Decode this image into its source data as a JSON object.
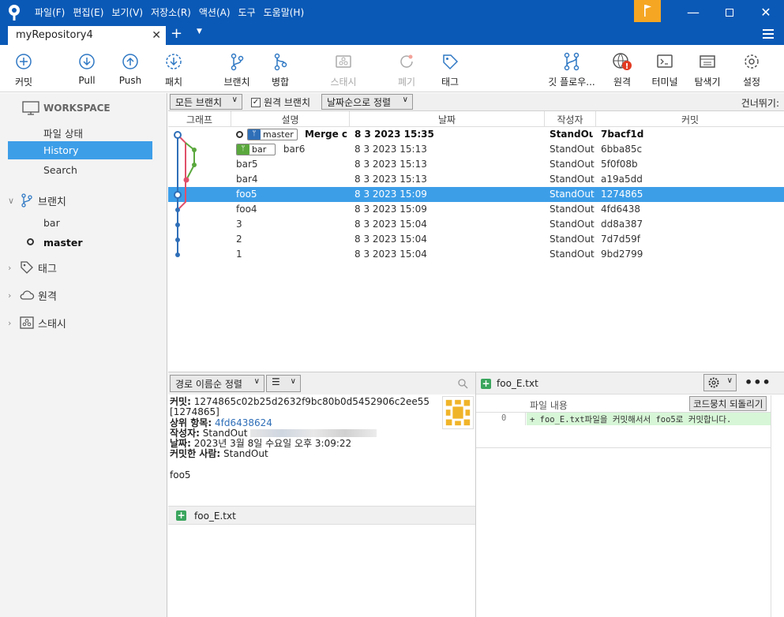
{
  "window": {
    "menu": [
      "파일(F)",
      "편집(E)",
      "보기(V)",
      "저장소(R)",
      "액션(A)",
      "도구",
      "도움말(H)"
    ],
    "tab_title": "myRepository4"
  },
  "toolbar": {
    "commit": "커밋",
    "pull": "Pull",
    "push": "Push",
    "fetch": "패치",
    "branch": "브랜치",
    "merge": "병합",
    "stash": "스태시",
    "discard": "폐기",
    "tag": "태그",
    "gitflow": "깃 플로우...",
    "remote": "원격",
    "terminal": "터미널",
    "explorer": "탐색기",
    "settings": "설정"
  },
  "sidebar": {
    "workspace_title": "WORKSPACE",
    "workspace_items": [
      "파일 상태",
      "History",
      "Search"
    ],
    "selected_item": "History",
    "branches_title": "브랜치",
    "branches": [
      "bar",
      "master"
    ],
    "current_branch": "master",
    "tags_title": "태그",
    "remotes_title": "원격",
    "stashes_title": "스태시"
  },
  "filters": {
    "branches": "모든 브랜치",
    "remote_branches": "원격 브랜치",
    "remote_checked": true,
    "sort": "날짜순으로 정렬",
    "jump": "건너뛰기:"
  },
  "columns": [
    "그래프",
    "설명",
    "날짜",
    "작성자",
    "커밋"
  ],
  "commits": [
    {
      "description": "Merge c",
      "ref": "master",
      "date": "8 3 2023 15:35",
      "author": "StandOut",
      "hash": "7bacf1d",
      "bold": true
    },
    {
      "description": "bar6",
      "ref": "bar",
      "date": "8 3 2023 15:13",
      "author": "StandOut",
      "hash": "6bba85c"
    },
    {
      "description": "bar5",
      "date": "8 3 2023 15:13",
      "author": "StandOut",
      "hash": "5f0f08b"
    },
    {
      "description": "bar4",
      "date": "8 3 2023 15:13",
      "author": "StandOut",
      "hash": "a19a5dd"
    },
    {
      "description": "foo5",
      "date": "8 3 2023 15:09",
      "author": "StandOut",
      "hash": "1274865",
      "selected": true
    },
    {
      "description": "foo4",
      "date": "8 3 2023 15:09",
      "author": "StandOut",
      "hash": "4fd6438"
    },
    {
      "description": "3",
      "date": "8 3 2023 15:04",
      "author": "StandOut",
      "hash": "dd8a387"
    },
    {
      "description": "2",
      "date": "8 3 2023 15:04",
      "author": "StandOut",
      "hash": "7d7d59f"
    },
    {
      "description": "1",
      "date": "8 3 2023 15:04",
      "author": "StandOut",
      "hash": "9bd2799"
    }
  ],
  "details": {
    "sort": "경로 이름순 정렬",
    "commit_label": "커밋:",
    "commit_full": "1274865c02b25d2632f9bc80b0d5452906c2ee55",
    "commit_short": "[1274865]",
    "parent_label": "상위 항목:",
    "parent": "4fd6438624",
    "author_label": "작성자:",
    "author": "StandOut",
    "date_label": "날짜:",
    "date": "2023년 3월 8일 수요일 오후 3:09:22",
    "committer_label": "커밋한 사람:",
    "committer": "StandOut",
    "message": "foo5",
    "file": "foo_E.txt"
  },
  "diff": {
    "file": "foo_E.txt",
    "content_label": "파일 내용",
    "revert_button": "코드뭉치 되돌리기",
    "line_number": "0",
    "line_text": "+ foo_E.txt파일을 커밋해서서 foo5로 커밋합니다."
  },
  "colors": {
    "titlebar": "#0a59b6",
    "selection": "#3d9ee8",
    "flag": "#f5a623"
  }
}
